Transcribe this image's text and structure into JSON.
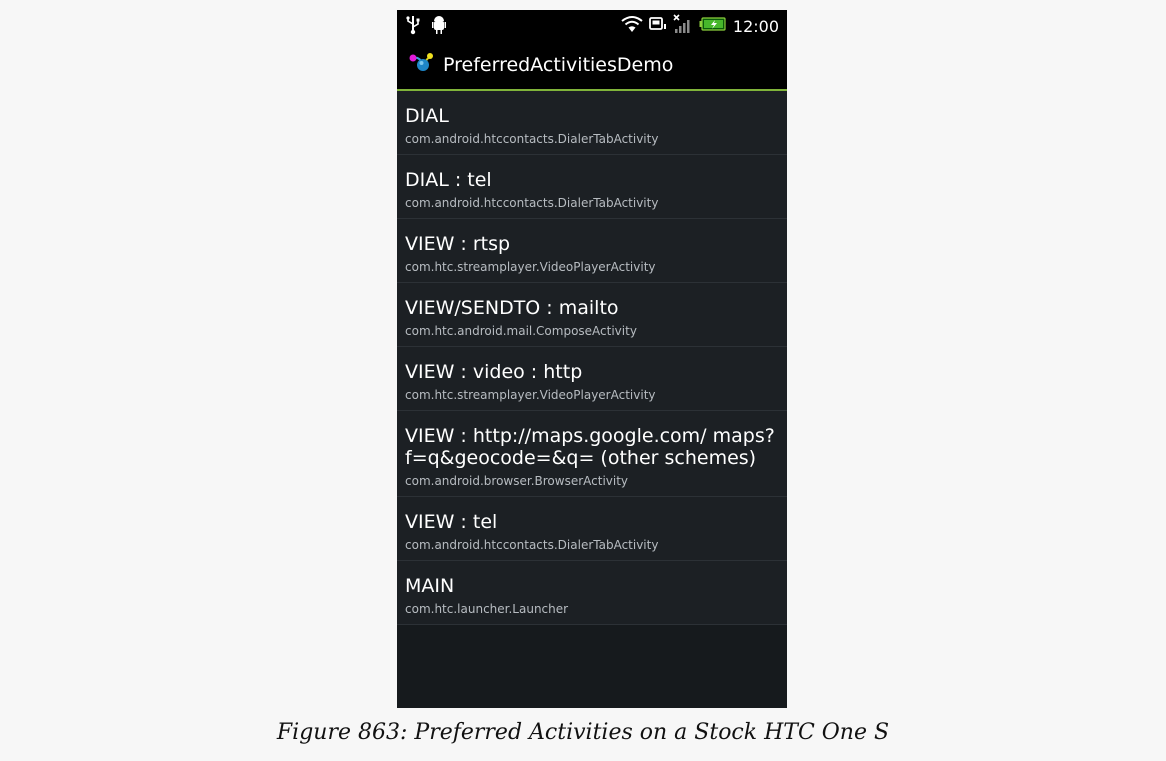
{
  "status": {
    "time": "12:00"
  },
  "app": {
    "title": "PreferredActivitiesDemo",
    "accent_color": "#80b43a"
  },
  "items": [
    {
      "title": "DIAL",
      "subtitle": "com.android.htccontacts.DialerTabActivity"
    },
    {
      "title": "DIAL : tel",
      "subtitle": "com.android.htccontacts.DialerTabActivity"
    },
    {
      "title": "VIEW : rtsp",
      "subtitle": "com.htc.streamplayer.VideoPlayerActivity"
    },
    {
      "title": "VIEW/SENDTO : mailto",
      "subtitle": "com.htc.android.mail.ComposeActivity"
    },
    {
      "title": "VIEW : video : http",
      "subtitle": "com.htc.streamplayer.VideoPlayerActivity"
    },
    {
      "title": "VIEW : http://maps.google.com/ maps?f=q&geocode=&q= (other schemes)",
      "subtitle": "com.android.browser.BrowserActivity"
    },
    {
      "title": "VIEW : tel",
      "subtitle": "com.android.htccontacts.DialerTabActivity"
    },
    {
      "title": "MAIN",
      "subtitle": "com.htc.launcher.Launcher"
    }
  ],
  "caption": "Figure 863: Preferred Activities on a Stock HTC One S"
}
